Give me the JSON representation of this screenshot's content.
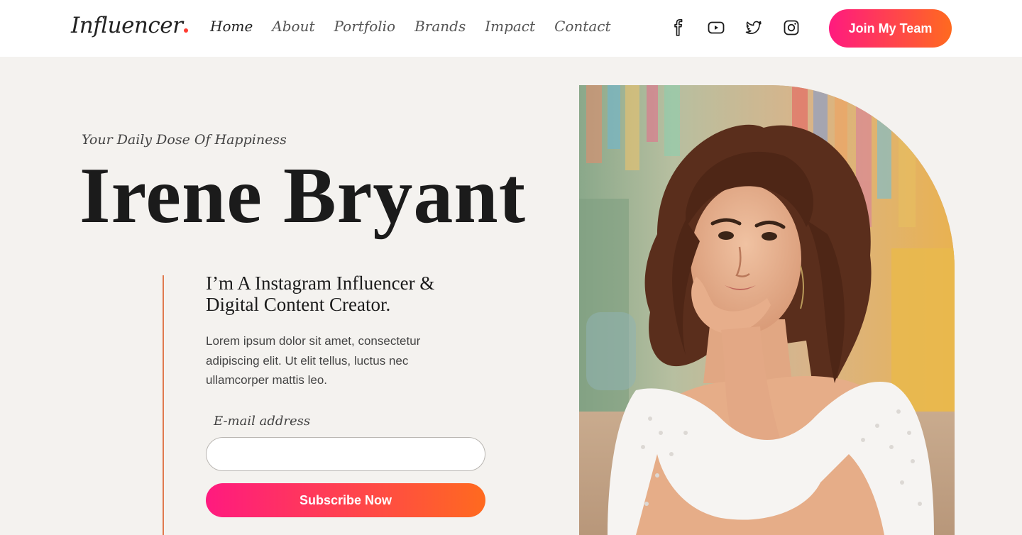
{
  "brand": {
    "name": "Influencer",
    "dot_color": "#ff3b30"
  },
  "nav": {
    "items": [
      {
        "label": "Home",
        "active": true
      },
      {
        "label": "About"
      },
      {
        "label": "Portfolio"
      },
      {
        "label": "Brands"
      },
      {
        "label": "Impact"
      },
      {
        "label": "Contact"
      }
    ]
  },
  "socials": [
    "facebook-icon",
    "youtube-icon",
    "twitter-icon",
    "instagram-icon"
  ],
  "header": {
    "cta_label": "Join My Team"
  },
  "hero": {
    "tagline": "Your Daily Dose Of Happiness",
    "name": "Irene Bryant",
    "role_line1": "I’m A Instagram Influencer &",
    "role_line2": "Digital Content Creator.",
    "description": "Lorem ipsum dolor sit amet, consectetur adipiscing elit. Ut elit tellus, luctus nec ullamcorper mattis leo.",
    "email_label": "E-mail address",
    "email_value": "",
    "email_placeholder": "",
    "subscribe_label": "Subscribe Now",
    "photo": "portrait-photo"
  },
  "colors": {
    "gradient_start": "#ff1a7f",
    "gradient_end": "#ff6a1f",
    "accent_line": "#e07a4e",
    "background": "#f4f2ef"
  }
}
